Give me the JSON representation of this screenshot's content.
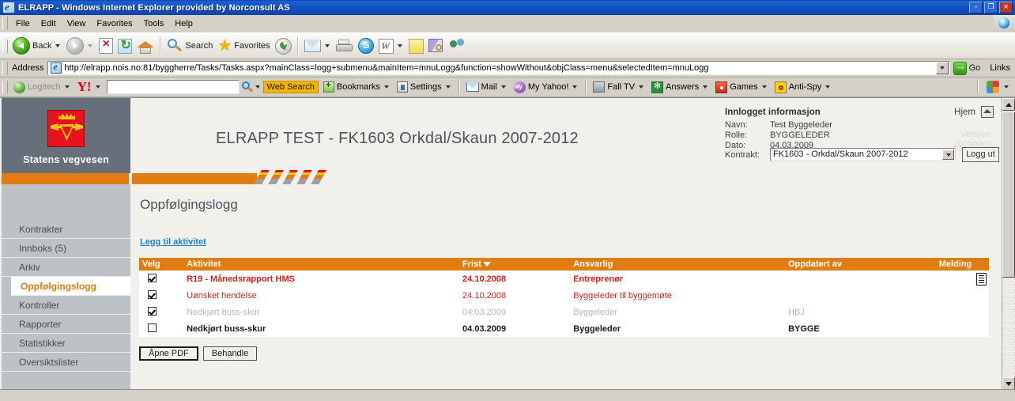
{
  "window": {
    "title": "ELRAPP - Windows Internet Explorer provided by Norconsult AS",
    "icon": "ie-page-icon",
    "minimize": "–",
    "maximize": "❐",
    "close": "×"
  },
  "menu": {
    "items": [
      {
        "label": "File",
        "accel": "F"
      },
      {
        "label": "Edit",
        "accel": "E"
      },
      {
        "label": "View",
        "accel": "V"
      },
      {
        "label": "Favorites",
        "accel": "a"
      },
      {
        "label": "Tools",
        "accel": "T"
      },
      {
        "label": "Help",
        "accel": "H"
      }
    ]
  },
  "toolbar": {
    "back_label": "Back",
    "search_label": "Search",
    "favorites_label": "Favorites",
    "icons": [
      "back-icon",
      "forward-icon",
      "stop-icon",
      "refresh-icon",
      "home-icon",
      "search-icon",
      "favorites-star-icon",
      "history-globe-icon",
      "mail-icon",
      "print-icon",
      "skype-icon",
      "word-icon",
      "note-icon",
      "research-icon",
      "messenger-icon"
    ]
  },
  "address": {
    "label": "Address",
    "url": "http://elrapp.nois.no:81/byggherre/Tasks/Tasks.aspx?mainClass=logg+submenu&mainItem=mnuLogg&function=showWithout&objClass=menu&selectedItem=mnuLogg",
    "go_label": "Go",
    "links_label": "Links"
  },
  "yahoo_bar": {
    "logitech_label": "Logitech",
    "yahoo_logo": "Y!",
    "search_value": "",
    "web_search_label": "Web Search",
    "bookmarks_label": "Bookmarks",
    "settings_label": "Settings",
    "mail_label": "Mail",
    "my_yahoo_label": "My Yahoo!",
    "fall_tv_label": "Fall TV",
    "answers_label": "Answers",
    "games_label": "Games",
    "antispy_label": "Anti-Spy"
  },
  "brand": {
    "name": "Statens vegvesen",
    "logo": "statens-vegvesen-shield-icon"
  },
  "hero": {
    "title": "ELRAPP TEST - FK1603 Orkdal/Skaun 2007-2012"
  },
  "info_box": {
    "title": "Innlogget informasjon",
    "rows": [
      {
        "label": "Navn:",
        "value": "Test Byggeleder"
      },
      {
        "label": "Rolle:",
        "value": "BYGGELEDER"
      },
      {
        "label": "Dato:",
        "value": "04.03.2009"
      }
    ],
    "contract_label": "Kontrakt:",
    "contract_value": "FK1603 - Orkdal/Skaun 2007-2012",
    "logout_label": "Logg ut",
    "home_label": "Hjem",
    "version_label": "Versjon:",
    "version_value": "20090303"
  },
  "sidebar": {
    "items": [
      {
        "label": "Kontrakter",
        "active": false
      },
      {
        "label": "Innboks (5)",
        "active": false
      },
      {
        "label": "Arkiv",
        "active": false
      },
      {
        "label": "Oppfølgingslogg",
        "active": true
      },
      {
        "label": "Kontroller",
        "active": false
      },
      {
        "label": "Rapporter",
        "active": false
      },
      {
        "label": "Statistikker",
        "active": false
      },
      {
        "label": "Oversiktslister",
        "active": false
      }
    ]
  },
  "main": {
    "page_title": "Oppfølgingslogg",
    "add_link": "Legg til aktivitet",
    "table": {
      "columns": [
        "Velg",
        "Aktivitet",
        "Frist",
        "Ansvarlig",
        "Oppdatert av",
        "Melding"
      ],
      "sorted_column": "Frist",
      "rows": [
        {
          "checked": true,
          "aktivitet": "R19 - Månedsrapport HMS",
          "frist": "24.10.2008",
          "ansvarlig": "Entreprenør",
          "oppdatert_av": "",
          "melding": "message-icon",
          "style": "red-bold"
        },
        {
          "checked": true,
          "aktivitet": "Uønsket hendelse",
          "frist": "24.10.2008",
          "ansvarlig": "Byggeleder til byggemøte",
          "oppdatert_av": "",
          "melding": "",
          "style": "red"
        },
        {
          "checked": true,
          "aktivitet": "Nedkjørt buss-skur",
          "frist": "04.03.2009",
          "ansvarlig": "Byggeleder",
          "oppdatert_av": "HBJ",
          "melding": "",
          "style": "gray"
        },
        {
          "checked": false,
          "aktivitet": "Nedkjørt buss-skur",
          "frist": "04.03.2009",
          "ansvarlig": "Byggeleder",
          "oppdatert_av": "BYGGE",
          "melding": "",
          "style": "black-bold"
        }
      ]
    },
    "buttons": [
      {
        "label": "Åpne PDF",
        "focused": true
      },
      {
        "label": "Behandle",
        "focused": false
      }
    ]
  },
  "colors": {
    "orange": "#e07c12",
    "sidebar": "#bdc2c6",
    "brand_bg": "#67707a",
    "link_blue": "#1f7fd0",
    "red": "#e01b1b",
    "page_bg": "#f1f0ea"
  }
}
